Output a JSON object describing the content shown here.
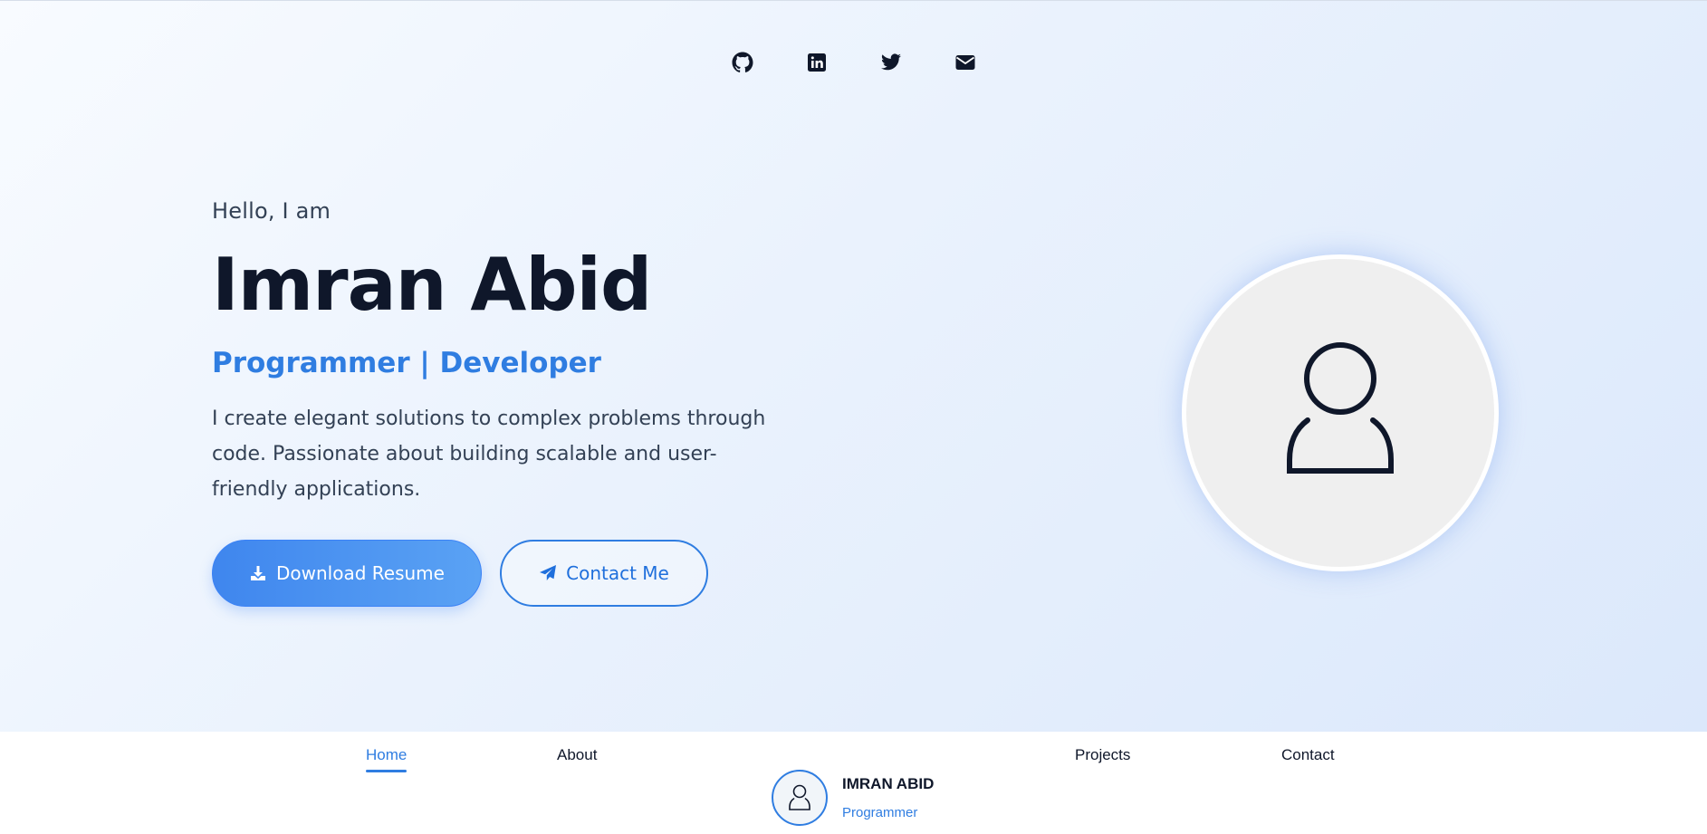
{
  "social_links": [
    {
      "icon": "github-icon"
    },
    {
      "icon": "linkedin-icon"
    },
    {
      "icon": "twitter-icon"
    },
    {
      "icon": "email-icon"
    }
  ],
  "hero": {
    "greeting": "Hello, I am",
    "name": "Imran Abid",
    "role": "Programmer | Developer",
    "description": "I create elegant solutions to complex problems through code. Passionate about building scalable and user-friendly applications.",
    "primary_button": {
      "label": "Download Resume",
      "icon": "download-icon"
    },
    "secondary_button": {
      "label": "Contact Me",
      "icon": "paper-plane-icon"
    },
    "avatar_icon": "user-icon"
  },
  "nav": {
    "items": [
      {
        "label": "Home",
        "active": true
      },
      {
        "label": "About",
        "active": false
      },
      {
        "label": "Projects",
        "active": false
      },
      {
        "label": "Contact",
        "active": false
      }
    ],
    "brand": {
      "name": "IMRAN ABID",
      "subtitle": "Programmer"
    }
  },
  "colors": {
    "accent": "#2f7de1",
    "text_dark": "#0f172a",
    "avatar_bg": "#efefef"
  }
}
